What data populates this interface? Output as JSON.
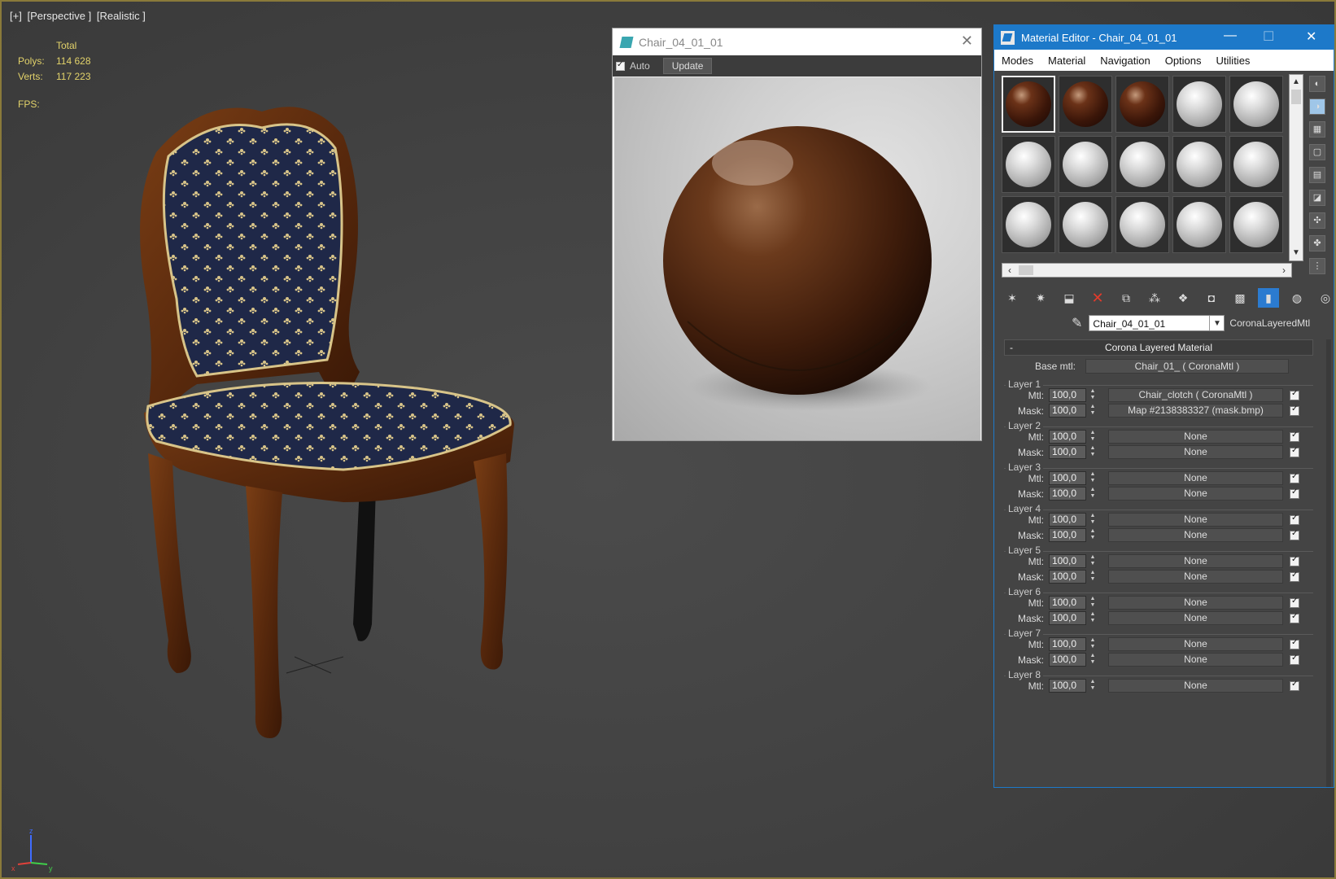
{
  "viewport": {
    "labels": [
      "[+]",
      "[Perspective ]",
      "[Realistic ]"
    ],
    "stats": {
      "header": "Total",
      "polys_label": "Polys:",
      "polys_value": "114 628",
      "verts_label": "Verts:",
      "verts_value": "117 223",
      "fps_label": "FPS:"
    },
    "axis": {
      "z": "z",
      "x": "x",
      "y": "y"
    }
  },
  "render_window": {
    "title": "Chair_04_01_01",
    "auto_label": "Auto",
    "update_label": "Update",
    "close_glyph": "✕"
  },
  "material_editor": {
    "title": "Material Editor - Chair_04_01_01",
    "window_buttons": {
      "minimize": "—",
      "maximize": "☐",
      "close": "✕"
    },
    "menu": [
      "Modes",
      "Material",
      "Navigation",
      "Options",
      "Utilities"
    ],
    "slots": [
      "wood",
      "wood",
      "wood",
      "grey",
      "grey",
      "grey",
      "grey",
      "grey",
      "grey",
      "grey",
      "grey",
      "grey",
      "grey",
      "grey",
      "grey"
    ],
    "material_name": "Chair_04_01_01",
    "material_type": "CoronaLayeredMtl",
    "rollout_title": "Corona Layered Material",
    "base_label": "Base mtl:",
    "base_value": "Chair_01_ ( CoronaMtl )",
    "mtl_label": "Mtl:",
    "mask_label": "Mask:",
    "layers": [
      {
        "name": "Layer 1",
        "mtl_amount": "100,0",
        "mtl": "Chair_clotch ( CoronaMtl )",
        "mask_amount": "100,0",
        "mask": "Map #2138383327 (mask.bmp)"
      },
      {
        "name": "Layer 2",
        "mtl_amount": "100,0",
        "mtl": "None",
        "mask_amount": "100,0",
        "mask": "None"
      },
      {
        "name": "Layer 3",
        "mtl_amount": "100,0",
        "mtl": "None",
        "mask_amount": "100,0",
        "mask": "None"
      },
      {
        "name": "Layer 4",
        "mtl_amount": "100,0",
        "mtl": "None",
        "mask_amount": "100,0",
        "mask": "None"
      },
      {
        "name": "Layer 5",
        "mtl_amount": "100,0",
        "mtl": "None",
        "mask_amount": "100,0",
        "mask": "None"
      },
      {
        "name": "Layer 6",
        "mtl_amount": "100,0",
        "mtl": "None",
        "mask_amount": "100,0",
        "mask": "None"
      },
      {
        "name": "Layer 7",
        "mtl_amount": "100,0",
        "mtl": "None",
        "mask_amount": "100,0",
        "mask": "None"
      },
      {
        "name": "Layer 8",
        "mtl_amount": "100,0",
        "mtl": "None"
      }
    ]
  },
  "colors": {
    "accent": "#1d79c9",
    "stats_text": "#e2d26a",
    "viewport_bg": "#444444",
    "viewport_border": "#8a7a3a"
  }
}
